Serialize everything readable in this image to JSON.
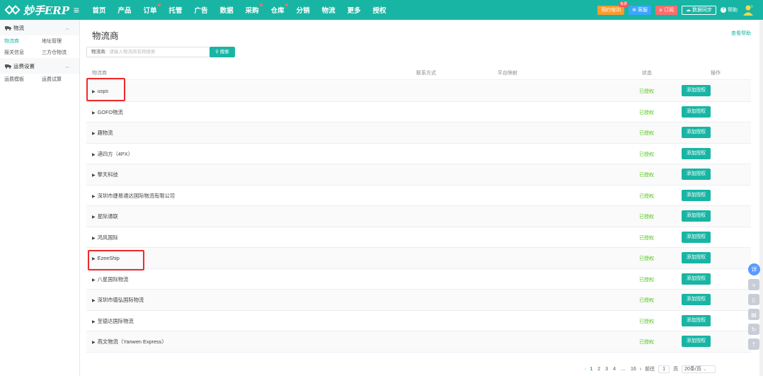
{
  "header": {
    "logo_text": "妙手ERP",
    "nav": [
      {
        "label": "首页",
        "dot": false
      },
      {
        "label": "产品",
        "dot": false
      },
      {
        "label": "订单",
        "dot": true
      },
      {
        "label": "托管",
        "dot": false
      },
      {
        "label": "广告",
        "dot": false
      },
      {
        "label": "数据",
        "dot": false
      },
      {
        "label": "采购",
        "dot": true
      },
      {
        "label": "仓库",
        "dot": true
      },
      {
        "label": "分销",
        "dot": false
      },
      {
        "label": "物流",
        "dot": false
      },
      {
        "label": "更多",
        "dot": false
      },
      {
        "label": "授权",
        "dot": false
      }
    ],
    "training_label": "预约培训",
    "free_badge": "免费",
    "service_label": "客服",
    "subscribe_label": "订阅",
    "sync_label": "数据同步",
    "help_label": "帮助"
  },
  "sidebar": {
    "groups": [
      {
        "title": "物流",
        "icon": "truck-icon",
        "items": [
          [
            "物流商",
            "地址管理"
          ],
          [
            "报关信息",
            "三方仓物流"
          ]
        ]
      },
      {
        "title": "运费设置",
        "icon": "truck-icon",
        "items": [
          [
            "运费模板",
            "运费试算"
          ]
        ]
      }
    ]
  },
  "main": {
    "title": "物流商",
    "help_link": "查看帮助",
    "search_label": "物流商:",
    "search_placeholder": "请输入物流商名称搜索",
    "search_button": "搜索",
    "columns": {
      "name": "物流商",
      "contact": "联系方式",
      "platform": "平台映射",
      "status": "状态",
      "action": "操作"
    },
    "rows": [
      {
        "name": "usps",
        "status": "已授权",
        "action": "添加授权"
      },
      {
        "name": "GOFO物流",
        "status": "已授权",
        "action": "添加授权"
      },
      {
        "name": "趣物流",
        "status": "已授权",
        "action": "添加授权"
      },
      {
        "name": "递四方（4PX）",
        "status": "已授权",
        "action": "添加授权"
      },
      {
        "name": "擎天科技",
        "status": "已授权",
        "action": "添加授权"
      },
      {
        "name": "深圳市捷易通达国际物流有限公司",
        "status": "已授权",
        "action": "添加授权"
      },
      {
        "name": "星际通联",
        "status": "已授权",
        "action": "添加授权"
      },
      {
        "name": "鸿风国际",
        "status": "已授权",
        "action": "添加授权"
      },
      {
        "name": "EzeeShip",
        "status": "已授权",
        "action": "添加授权"
      },
      {
        "name": "八星国际物流",
        "status": "已授权",
        "action": "添加授权"
      },
      {
        "name": "深圳市德弘国际物流",
        "status": "已授权",
        "action": "添加授权"
      },
      {
        "name": "至德达国际物流",
        "status": "已授权",
        "action": "添加授权"
      },
      {
        "name": "燕文物流（Yanwen Express）",
        "status": "已授权",
        "action": "添加授权"
      }
    ],
    "pagination": {
      "pages": [
        "1",
        "2",
        "3",
        "4",
        "…",
        "16"
      ],
      "current": "1",
      "goto_label": "前往",
      "goto_value": "1",
      "page_unit": "页",
      "page_size": "20条/页"
    },
    "float_detail": "详"
  },
  "colors": {
    "brand": "#19b5a4",
    "status_green": "#52c41a",
    "highlight_red": "#f02a2a"
  }
}
